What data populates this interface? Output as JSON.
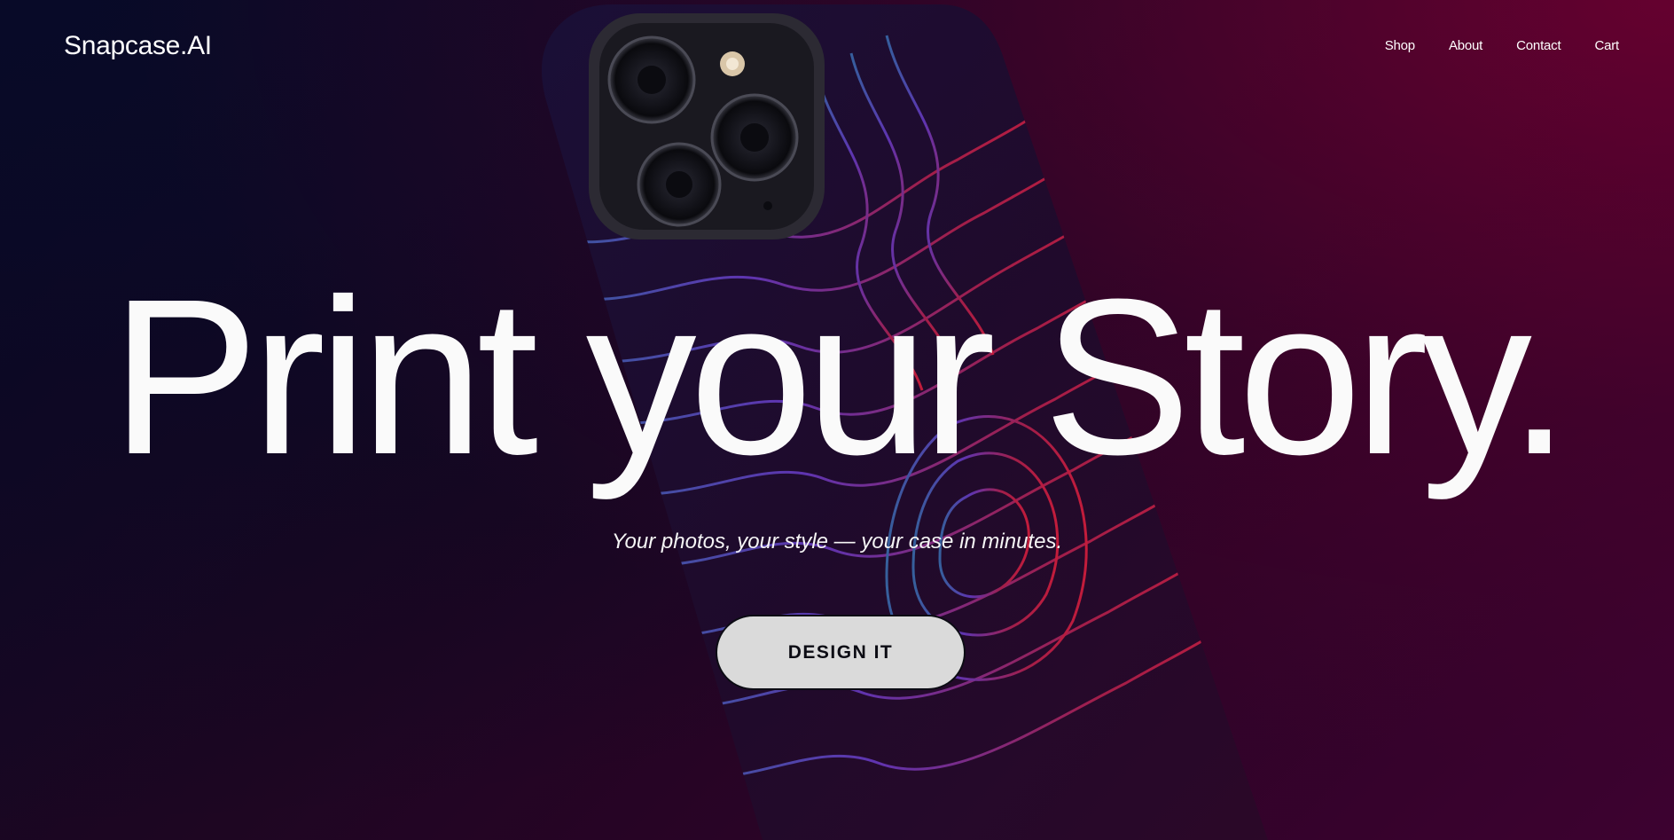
{
  "header": {
    "logo": "Snapcase.AI",
    "nav": [
      {
        "label": "Shop"
      },
      {
        "label": "About"
      },
      {
        "label": "Contact"
      },
      {
        "label": "Cart"
      }
    ]
  },
  "hero": {
    "headline": "Print your Story.",
    "subtitle": "Your photos, your style — your case in minutes.",
    "cta_label": "DESIGN IT",
    "image_icon": "phone-case-image"
  },
  "colors": {
    "background_dark": "#0a0a25",
    "background_magenta": "#4a0030",
    "text": "#ffffff",
    "button_bg": "#dadada",
    "button_text": "#0c0c14",
    "case_lines_red": "#e0203e",
    "case_lines_purple": "#6a3cc8",
    "case_lines_blue": "#3a6fb0"
  }
}
